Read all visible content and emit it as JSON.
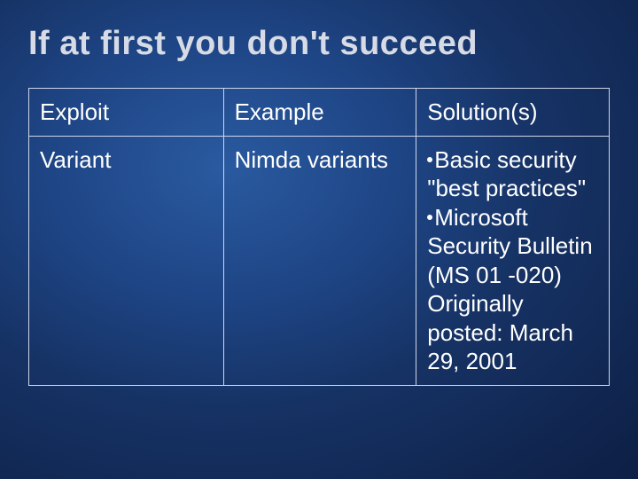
{
  "title": "If at first you don't succeed",
  "table": {
    "header": {
      "exploit": "Exploit",
      "example": "Example",
      "solution": "Solution(s)"
    },
    "row": {
      "exploit": "Variant",
      "example": "Nimda variants",
      "solution_item1": "Basic security \"best practices\"",
      "solution_item2": "Microsoft Security Bulletin (MS 01 -020) Originally posted: March 29, 2001"
    }
  }
}
